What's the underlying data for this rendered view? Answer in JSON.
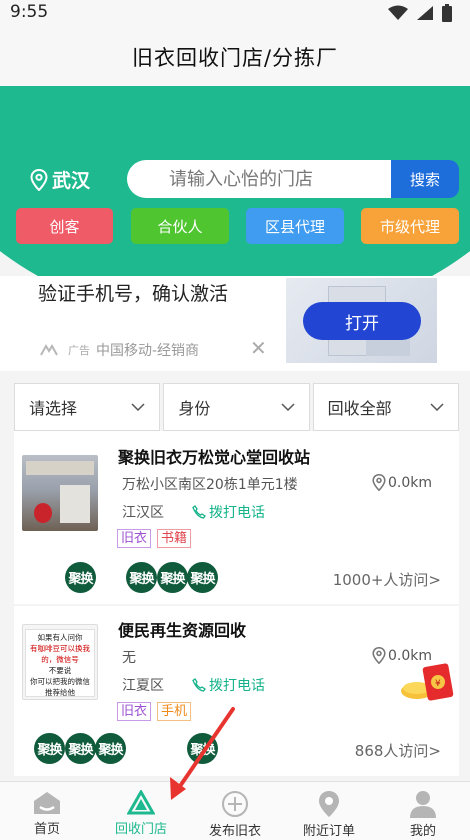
{
  "status_bar": {
    "time": "9:55"
  },
  "header": {
    "title": "旧衣回收门店/分拣厂"
  },
  "location": {
    "city": "武汉"
  },
  "search": {
    "placeholder": "请输入心怡的门店",
    "button_label": "搜索"
  },
  "roles": [
    {
      "label": "创客",
      "color": "#ef5b67"
    },
    {
      "label": "合伙人",
      "color": "#4fc530"
    },
    {
      "label": "区县代理",
      "color": "#3f9cf0"
    },
    {
      "label": "市级代理",
      "color": "#f7a33a"
    }
  ],
  "ad": {
    "title": "验证手机号，确认激活",
    "tag": "广告",
    "source": "中国移动-经销商",
    "button_label": "打开"
  },
  "filters": [
    {
      "label": "请选择"
    },
    {
      "label": "身份"
    },
    {
      "label": "回收全部"
    }
  ],
  "stores": [
    {
      "name": "聚换旧衣万松觉心堂回收站",
      "address": "万松小区南区20栋1单元1楼",
      "distance": "0.0km",
      "district": "江汉区",
      "call": "拨打电话",
      "tags": [
        "旧衣",
        "书籍"
      ],
      "badges": [
        "聚换",
        "聚换",
        "聚换",
        "聚换"
      ],
      "visits": "1000+人访问>"
    },
    {
      "name": "便民再生资源回收",
      "address": "无",
      "distance": "0.0km",
      "district": "江夏区",
      "call": "拨打电话",
      "tags": [
        "旧衣",
        "手机"
      ],
      "badges": [
        "聚换",
        "聚换",
        "聚换",
        "聚换"
      ],
      "visits": "868人访问>",
      "photo_text": [
        "如果有人问你",
        "有咖啡豆可以换我的，微信号",
        "不要说",
        "你可以把我的微信",
        "推荐给他"
      ]
    }
  ],
  "bottom_nav": [
    {
      "label": "首页",
      "icon": "home-icon"
    },
    {
      "label": "回收门店",
      "icon": "recycle-icon"
    },
    {
      "label": "发布旧衣",
      "icon": "add-circle-icon"
    },
    {
      "label": "附近订单",
      "icon": "location-pin-icon"
    },
    {
      "label": "我的",
      "icon": "user-icon"
    }
  ],
  "colors": {
    "brand_green": "#1fb98f",
    "search_blue": "#1d6ddb",
    "badge_green": "#0f5b3c"
  }
}
